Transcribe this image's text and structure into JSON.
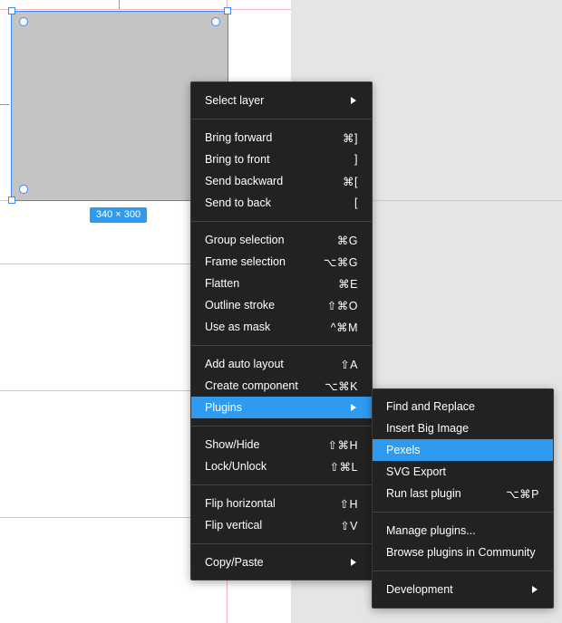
{
  "canvas": {
    "size_label": "340 × 300"
  },
  "context_menu": {
    "items": [
      {
        "label": "Select layer",
        "shortcut": "",
        "submenu": true
      },
      {
        "label": "Bring forward",
        "shortcut": "⌘]"
      },
      {
        "label": "Bring to front",
        "shortcut": "]"
      },
      {
        "label": "Send backward",
        "shortcut": "⌘["
      },
      {
        "label": "Send to back",
        "shortcut": "["
      },
      {
        "label": "Group selection",
        "shortcut": "⌘G"
      },
      {
        "label": "Frame selection",
        "shortcut": "⌥⌘G"
      },
      {
        "label": "Flatten",
        "shortcut": "⌘E"
      },
      {
        "label": "Outline stroke",
        "shortcut": "⇧⌘O"
      },
      {
        "label": "Use as mask",
        "shortcut": "^⌘M"
      },
      {
        "label": "Add auto layout",
        "shortcut": "⇧A"
      },
      {
        "label": "Create component",
        "shortcut": "⌥⌘K"
      },
      {
        "label": "Plugins",
        "shortcut": "",
        "submenu": true,
        "highlighted": true
      },
      {
        "label": "Show/Hide",
        "shortcut": "⇧⌘H"
      },
      {
        "label": "Lock/Unlock",
        "shortcut": "⇧⌘L"
      },
      {
        "label": "Flip horizontal",
        "shortcut": "⇧H"
      },
      {
        "label": "Flip vertical",
        "shortcut": "⇧V"
      },
      {
        "label": "Copy/Paste",
        "shortcut": "",
        "submenu": true
      }
    ]
  },
  "plugins_submenu": {
    "items": [
      {
        "label": "Find and Replace",
        "shortcut": ""
      },
      {
        "label": "Insert Big Image",
        "shortcut": ""
      },
      {
        "label": "Pexels",
        "shortcut": "",
        "highlighted": true
      },
      {
        "label": "SVG Export",
        "shortcut": ""
      },
      {
        "label": "Run last plugin",
        "shortcut": "⌥⌘P"
      },
      {
        "label": "Manage plugins...",
        "shortcut": ""
      },
      {
        "label": "Browse plugins in Community",
        "shortcut": ""
      },
      {
        "label": "Development",
        "shortcut": "",
        "submenu": true
      }
    ]
  },
  "colors": {
    "accent": "#2f9bf0",
    "menu_bg": "#222222",
    "canvas_gray": "#e5e5e5",
    "guide": "#f2b8bd",
    "shape_fill": "#c4c4c4"
  }
}
